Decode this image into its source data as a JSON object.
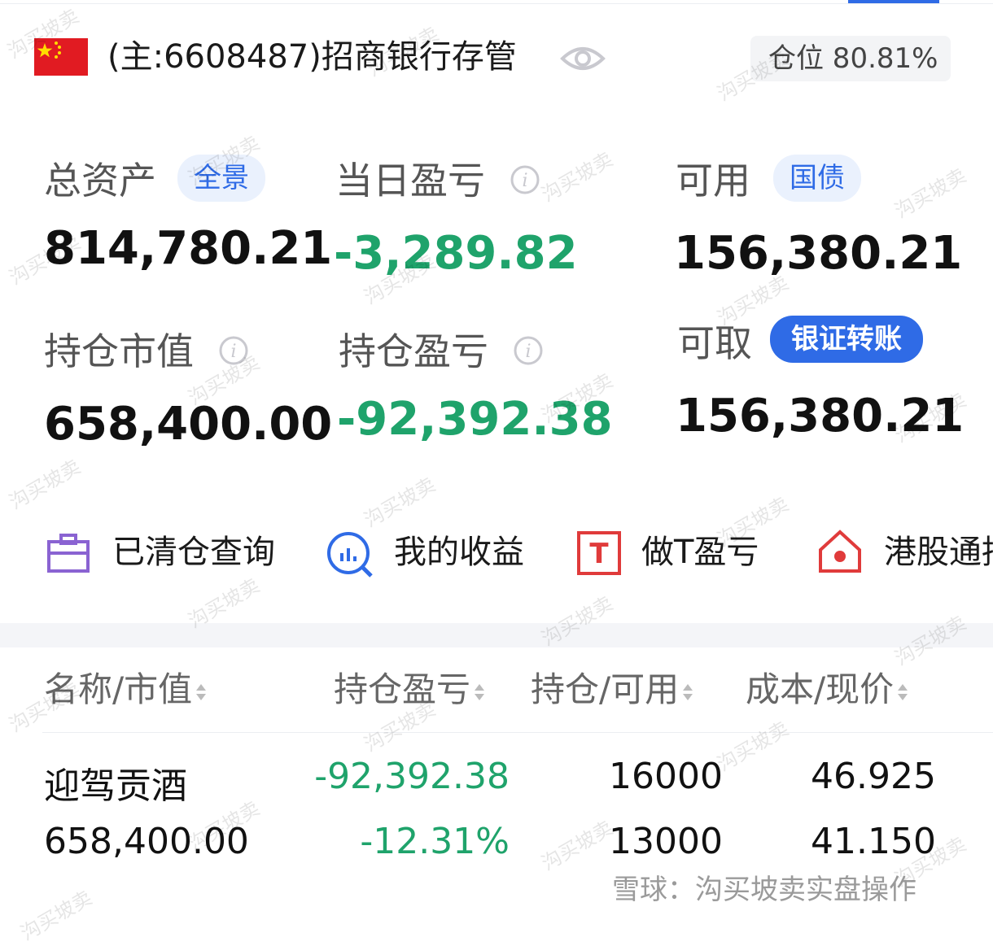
{
  "header": {
    "account_label": "(主:6608487)招商银行存管",
    "position_badge": "仓位 80.81%"
  },
  "stats": {
    "total_assets": {
      "label": "总资产",
      "tag": "全景",
      "value": "814,780.21"
    },
    "daily_pnl": {
      "label": "当日盈亏",
      "value": "-3,289.82"
    },
    "available": {
      "label": "可用",
      "tag": "国债",
      "value": "156,380.21"
    },
    "market_value": {
      "label": "持仓市值",
      "value": "658,400.00"
    },
    "position_pnl": {
      "label": "持仓盈亏",
      "value": "-92,392.38"
    },
    "withdrawable": {
      "label": "可取",
      "tag": "银证转账",
      "value": "156,380.21"
    }
  },
  "quick_actions": [
    {
      "label": "已清仓查询",
      "icon": "briefcase-icon"
    },
    {
      "label": "我的收益",
      "icon": "earnings-chart-icon"
    },
    {
      "label": "做T盈亏",
      "icon": "t-box-icon"
    },
    {
      "label": "港股通持",
      "icon": "hk-house-icon"
    }
  ],
  "table": {
    "headers": [
      "名称/市值",
      "持仓盈亏",
      "持仓/可用",
      "成本/现价"
    ],
    "rows": [
      {
        "name": "迎驾贡酒",
        "market_value": "658,400.00",
        "pnl": "-92,392.38",
        "pnl_pct": "-12.31%",
        "holding": "16000",
        "available": "13000",
        "cost": "46.925",
        "price": "41.150"
      }
    ]
  },
  "watermark": "沟买坡卖",
  "footer": "雪球：沟买坡卖实盘操作",
  "colors": {
    "accent": "#2f6be6",
    "loss": "#1fa36b",
    "flag": "#e11b22"
  }
}
